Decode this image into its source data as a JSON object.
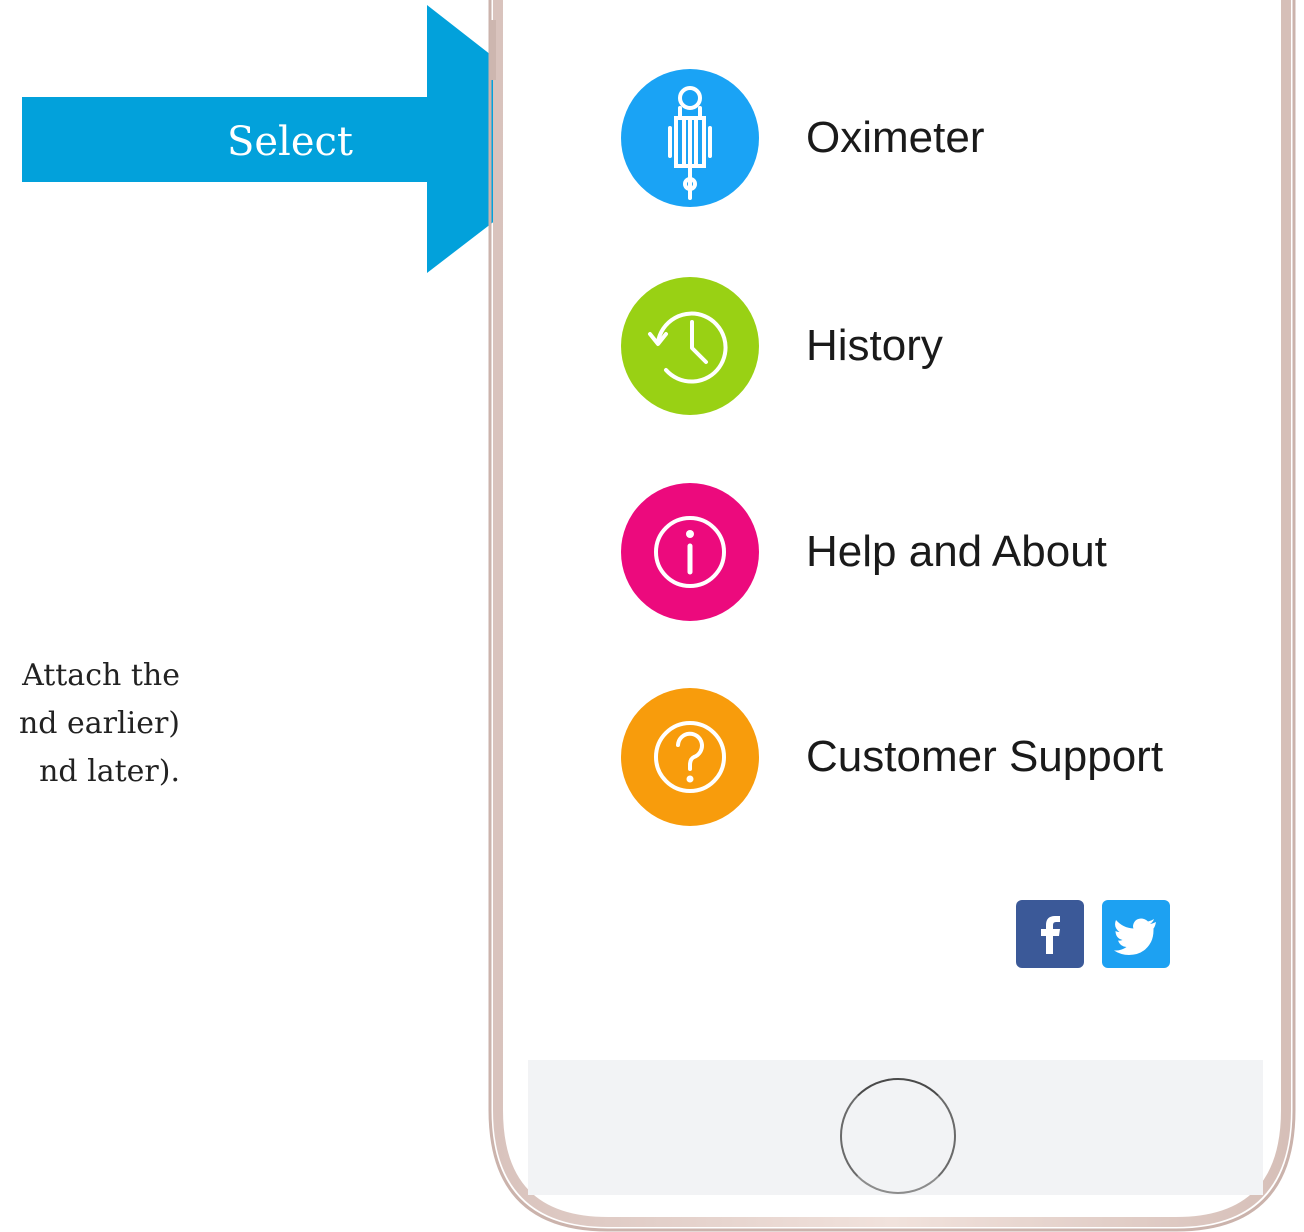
{
  "annotation": {
    "arrow_label": "Select",
    "arrow_color": "#02a1db",
    "side_text_lines": [
      "Attach the",
      "nd earlier)",
      "nd later)."
    ]
  },
  "menu": {
    "items": [
      {
        "label": "Oximeter",
        "icon": "oximeter-probe-icon",
        "color": "#1aa3f5"
      },
      {
        "label": "History",
        "icon": "history-clock-icon",
        "color": "#99d114"
      },
      {
        "label": "Help and About",
        "icon": "info-icon",
        "color": "#ec0a7d"
      },
      {
        "label": "Customer Support",
        "icon": "question-icon",
        "color": "#f89c0c"
      }
    ]
  },
  "social": {
    "facebook": {
      "icon": "facebook-icon",
      "color": "#3b5998"
    },
    "twitter": {
      "icon": "twitter-icon",
      "color": "#1da1f2"
    }
  },
  "device": {
    "home_button": "home-button",
    "frame_color": "#e9d6d0"
  }
}
